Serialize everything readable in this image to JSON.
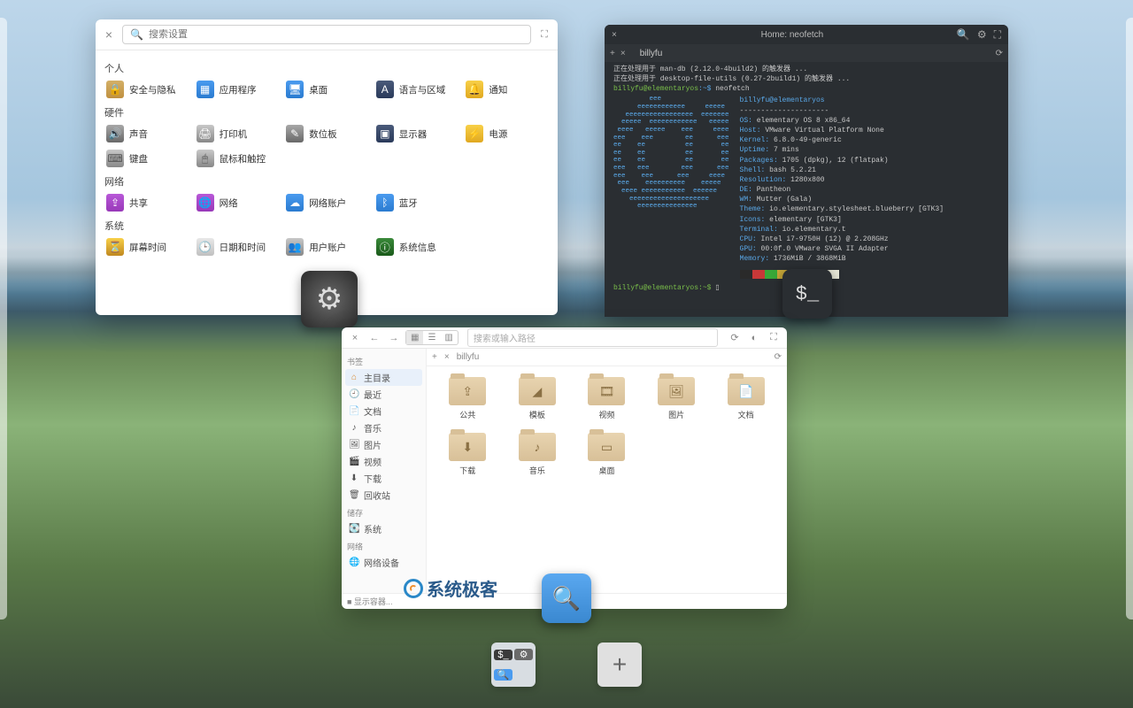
{
  "settings": {
    "search_placeholder": "搜索设置",
    "sections": {
      "personal": "个人",
      "hardware": "硬件",
      "network": "网络",
      "system": "系统"
    },
    "items": {
      "security": "安全与隐私",
      "apps": "应用程序",
      "desktop": "桌面",
      "locale": "语言与区域",
      "notify": "通知",
      "sound": "声音",
      "printer": "打印机",
      "tablet": "数位板",
      "display": "显示器",
      "power": "电源",
      "keyboard": "键盘",
      "mouse": "鼠标和触控",
      "share": "共享",
      "network": "网络",
      "online": "网络账户",
      "bluetooth": "蓝牙",
      "screentime": "屏幕时间",
      "datetime": "日期和时间",
      "users": "用户账户",
      "about": "系统信息"
    }
  },
  "terminal": {
    "title": "Home: neofetch",
    "tab": "billyfu",
    "line1": "正在处理用于 man-db (2.12.0-4build2) 的触发器 ...",
    "line2": "正在处理用于 desktop-file-utils (0.27-2build1) 的触发器 ...",
    "prompt_user": "billyfu@elementaryos",
    "prompt_path": ":~$",
    "cmd": "neofetch",
    "info": {
      "header": "billyfu@elementaryos",
      "os_k": "OS:",
      "os_v": "elementary OS 8 x86_64",
      "host_k": "Host:",
      "host_v": "VMware Virtual Platform None",
      "kernel_k": "Kernel:",
      "kernel_v": "6.8.0-49-generic",
      "uptime_k": "Uptime:",
      "uptime_v": "7 mins",
      "pkg_k": "Packages:",
      "pkg_v": "1705 (dpkg), 12 (flatpak)",
      "shell_k": "Shell:",
      "shell_v": "bash 5.2.21",
      "res_k": "Resolution:",
      "res_v": "1280x800",
      "de_k": "DE:",
      "de_v": "Pantheon",
      "wm_k": "WM:",
      "wm_v": "Mutter (Gala)",
      "theme_k": "Theme:",
      "theme_v": "io.elementary.stylesheet.blueberry [GTK3]",
      "icons_k": "Icons:",
      "icons_v": "elementary [GTK3]",
      "term_k": "Terminal:",
      "term_v": "io.elementary.t",
      "cpu_k": "CPU:",
      "cpu_v": "Intel i7-9750H (12) @ 2.208GHz",
      "gpu_k": "GPU:",
      "gpu_v": "00:0f.0 VMware SVGA II Adapter",
      "mem_k": "Memory:",
      "mem_v": "1736MiB / 3868MiB"
    },
    "logo": "         eee\n      eeeeeeeeeeee     eeeee\n   eeeeeeeeeeeeeeeee  eeeeeee\n  eeeee  eeeeeeeeeeee   eeeee\n eeee   eeeee    eee     eeee\neee    eee        ee      eee\nee    ee          ee       ee\nee    ee          ee       ee\nee    ee          ee       ee\neee   eee        eee      eee\neee    eee      eee     eeee\n eee    eeeeeeeeee    eeeee\n  eeee eeeeeeeeeee  eeeeee\n    eeeeeeeeeeeeeeeeeeee\n      eeeeeeeeeeeeeee",
    "prompt2": "billyfu@elementaryos:~$",
    "overlay": "$_"
  },
  "files": {
    "path_placeholder": "搜索或输入路径",
    "tab": "billyfu",
    "sidebar": {
      "bookmarks": "书签",
      "home": "主目录",
      "recent": "最近",
      "documents": "文档",
      "music": "音乐",
      "pictures": "图片",
      "videos": "视频",
      "downloads": "下载",
      "trash": "回收站",
      "storage": "储存",
      "system": "系统",
      "network_h": "网络",
      "network": "网络设备"
    },
    "folders": {
      "public": "公共",
      "templates": "模板",
      "videos": "视频",
      "pictures": "图片",
      "documents": "文档",
      "downloads": "下载",
      "music": "音乐",
      "desktop": "桌面"
    },
    "footer": "■ 显示容器..."
  },
  "watermark": "系统极客",
  "dock": {
    "add": "+"
  }
}
